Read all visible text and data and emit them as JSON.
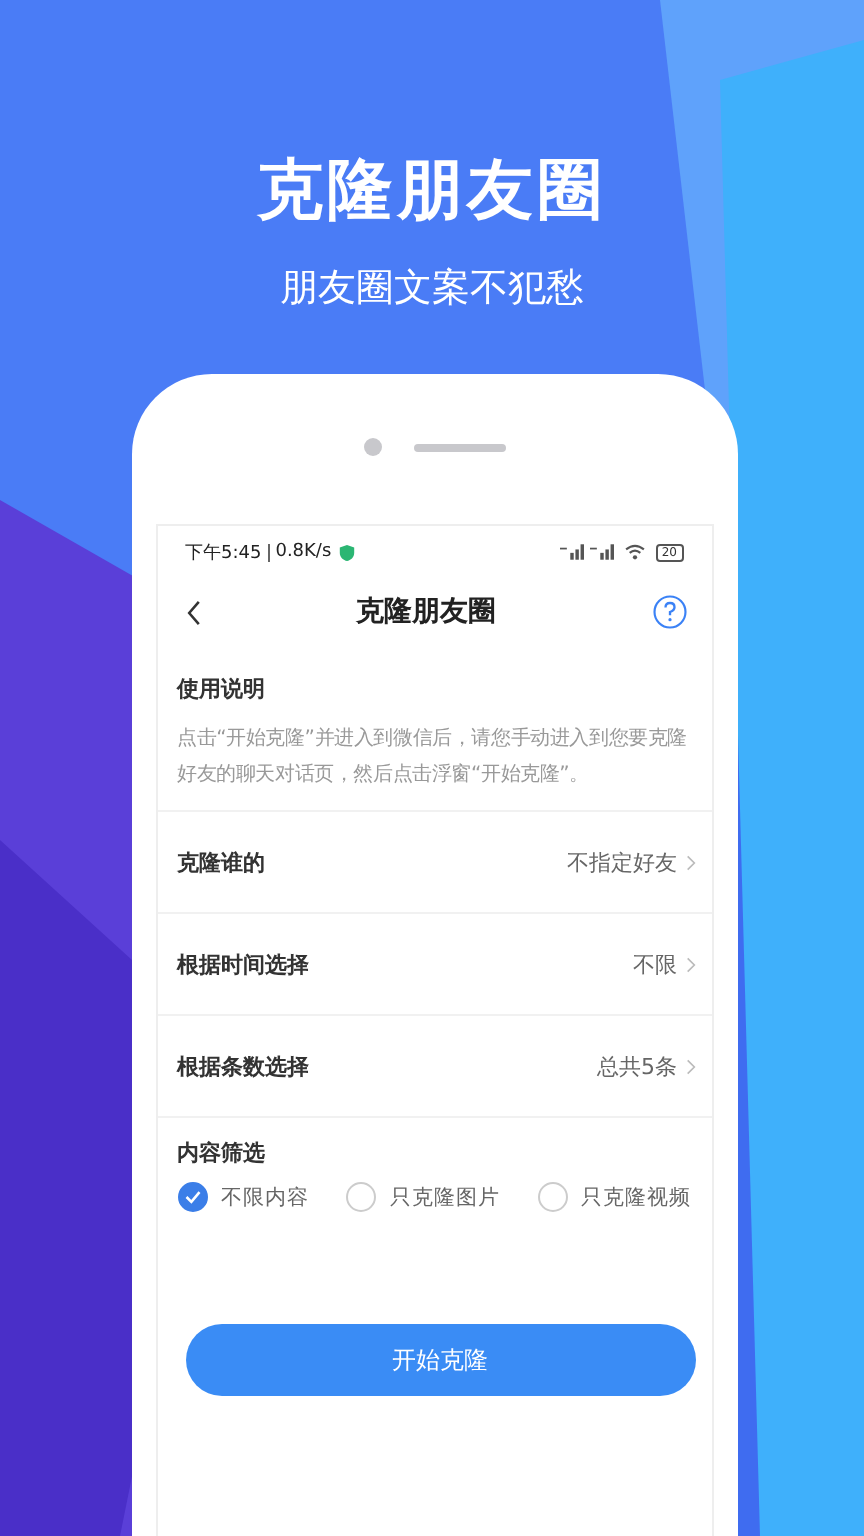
{
  "headline": "克隆朋友圈",
  "tagline": "朋友圈文案不犯愁",
  "status_bar": {
    "time": "下午5:45",
    "speed": "0.8K/s",
    "battery": "20"
  },
  "nav": {
    "title": "克隆朋友圈"
  },
  "instructions": {
    "title": "使用说明",
    "text": "点击“开始克隆”并进入到微信后，请您手动进入到您要克隆好友的聊天对话页，然后点击浮窗“开始克隆”。"
  },
  "settings": [
    {
      "label": "克隆谁的",
      "value": "不指定好友"
    },
    {
      "label": "根据时间选择",
      "value": "不限"
    },
    {
      "label": "根据条数选择",
      "value": "总共5条"
    }
  ],
  "filter": {
    "title": "内容筛选",
    "options": [
      {
        "label": "不限内容",
        "selected": true
      },
      {
        "label": "只克隆图片",
        "selected": false
      },
      {
        "label": "只克隆视频",
        "selected": false
      }
    ]
  },
  "start_button": "开始克隆"
}
